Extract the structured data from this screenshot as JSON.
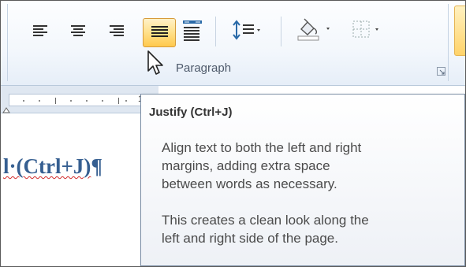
{
  "ribbon": {
    "group_label": "Paragraph",
    "controls": [
      {
        "name": "align-left",
        "icon": "align-left-icon"
      },
      {
        "name": "center",
        "icon": "align-center-icon"
      },
      {
        "name": "align-right",
        "icon": "align-right-icon"
      },
      {
        "name": "justify",
        "icon": "justify-icon",
        "state": "hovered"
      },
      {
        "name": "distributed",
        "icon": "distributed-icon"
      },
      {
        "name": "line-spacing",
        "icon": "line-spacing-icon"
      },
      {
        "name": "shading",
        "icon": "paint-bucket-icon"
      },
      {
        "name": "borders",
        "icon": "borders-icon"
      }
    ],
    "highlight_color": "#ffd86a"
  },
  "ruler": {
    "number": "1"
  },
  "document": {
    "text": "l·(Ctrl+J)",
    "mark": "¶"
  },
  "tooltip": {
    "title": "Justify (Ctrl+J)",
    "paragraph1": "Align text to both the left and right\nmargins, adding extra space\nbetween words as necessary.",
    "paragraph2": "This creates a clean look along the\nleft and right side of the page."
  },
  "colors": {
    "doc_heading": "#365f91",
    "accent": "#f3c44d"
  }
}
